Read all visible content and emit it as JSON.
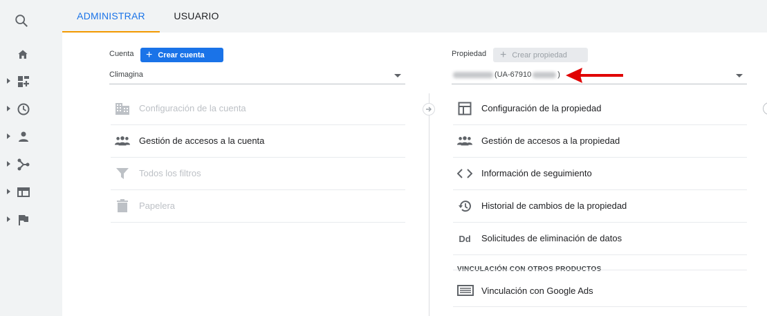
{
  "tabs": [
    {
      "label": "ADMINISTRAR",
      "active": true
    },
    {
      "label": "USUARIO",
      "active": false
    }
  ],
  "rail": {
    "icons": [
      "search-icon",
      "home-icon",
      "dashboard-icon",
      "clock-icon",
      "person-icon",
      "branch-icon",
      "browser-icon",
      "flag-icon"
    ]
  },
  "account": {
    "label": "Cuenta",
    "create_label": "Crear cuenta",
    "selected": "Climagina",
    "items": [
      {
        "label": "Configuración de la cuenta",
        "icon": "building-icon",
        "enabled": false
      },
      {
        "label": "Gestión de accesos a la cuenta",
        "icon": "people-icon",
        "enabled": true
      },
      {
        "label": "Todos los filtros",
        "icon": "filter-icon",
        "enabled": false
      },
      {
        "label": "Papelera",
        "icon": "trash-icon",
        "enabled": false
      }
    ]
  },
  "property": {
    "label": "Propiedad",
    "create_label": "Crear propiedad",
    "selected_visible": "(UA-67910",
    "items": [
      {
        "label": "Configuración de la propiedad",
        "icon": "layout-icon",
        "enabled": true
      },
      {
        "label": "Gestión de accesos a la propiedad",
        "icon": "people-icon",
        "enabled": true
      },
      {
        "label": "Información de seguimiento",
        "icon": "code-icon",
        "enabled": true
      },
      {
        "label": "Historial de cambios de la propiedad",
        "icon": "history-icon",
        "enabled": true
      },
      {
        "label": "Solicitudes de eliminación de datos",
        "icon": "dd-icon",
        "icon_text": "Dd",
        "enabled": true
      }
    ],
    "section_title": "VINCULACIÓN CON OTROS PRODUCTOS",
    "links": [
      {
        "label": "Vinculación con Google Ads",
        "icon": "ads-icon"
      }
    ]
  },
  "colors": {
    "accent": "#1a73e8",
    "tab_underline": "#f29900",
    "annotation_arrow": "#e00000"
  }
}
